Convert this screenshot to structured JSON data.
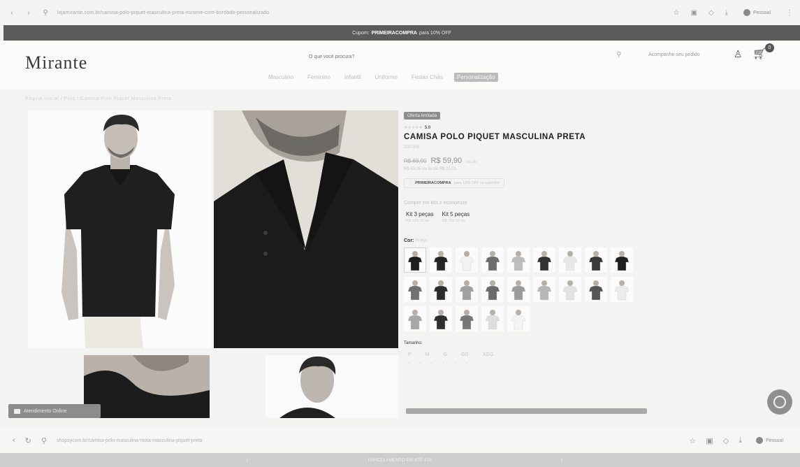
{
  "browser": {
    "url": "lojamirante.com.br/camisa-polo-piquet-masculina-preta-mirante-com-bordado-personalizado",
    "profile_label": "Pessoal"
  },
  "coupon_banner": {
    "prefix": "Cupom:",
    "code": "PRIMEIRACOMPRA",
    "suffix": "para 10% OFF"
  },
  "header": {
    "logo": "Mirante",
    "search_placeholder": "O que você procura?",
    "account_label": "Acompanhe seu pedido",
    "cart_count": "0",
    "nav": [
      "Masculino",
      "Feminino",
      "Infantil",
      "Uniforme",
      "Festas Chás",
      "Personalização"
    ]
  },
  "breadcrumb": "Página inicial  /  Polo  /  Camisa Polo Piquet Masculina Preta",
  "product": {
    "badge": "Oferta limitada",
    "stars": "★★★★★",
    "score": "5.0",
    "title": "CAMISA POLO PIQUET MASCULINA PRETA",
    "sku": "200.009",
    "old_price": "R$ 69,90",
    "new_price": "R$ 59,90",
    "off": "no pix",
    "installments": "R$ 63,05 ou 3x de R$ 21,01",
    "coupon_code": "PRIMEIRACOMPRA",
    "coupon_text": "para 10% OFF no carrinho",
    "kit_heading": "Compre em kits e economize",
    "kits": [
      {
        "name": "Kit 3 peças",
        "price": "R$ 169,70 un"
      },
      {
        "name": "Kit 5 peças",
        "price": "R$ 259,50 un"
      }
    ],
    "color_label": "Cor:",
    "color_value": "Preta",
    "swatch_colors": [
      "#1d1d1d",
      "#262626",
      "#f2f2f2",
      "#6d6d6d",
      "#bdbdbd",
      "#333333",
      "#e8e8e8",
      "#3a3a3a",
      "#202020",
      "#707070",
      "#2c2c2c",
      "#a0a0a0",
      "#6a6a6a",
      "#9b9b9b",
      "#b7b7b7",
      "#e2e2e2",
      "#555555",
      "#ececec",
      "#a8a8a8",
      "#2e2e2e",
      "#777777",
      "#dedede",
      "#f4f4f4"
    ],
    "size_label": "Tamanho:",
    "sizes": [
      "P",
      "M",
      "G",
      "GG",
      "XGG"
    ],
    "stock_hint": "● ● ● ● ● ●"
  },
  "chat": {
    "label": "Atendimento Online"
  },
  "bottom_browser": {
    "url": "shopsycom.br/camisa-polo-masculina-mota-masculina-piquet-preta"
  },
  "installment_banner": "PARCELAMENTO EM ATÉ 10X"
}
